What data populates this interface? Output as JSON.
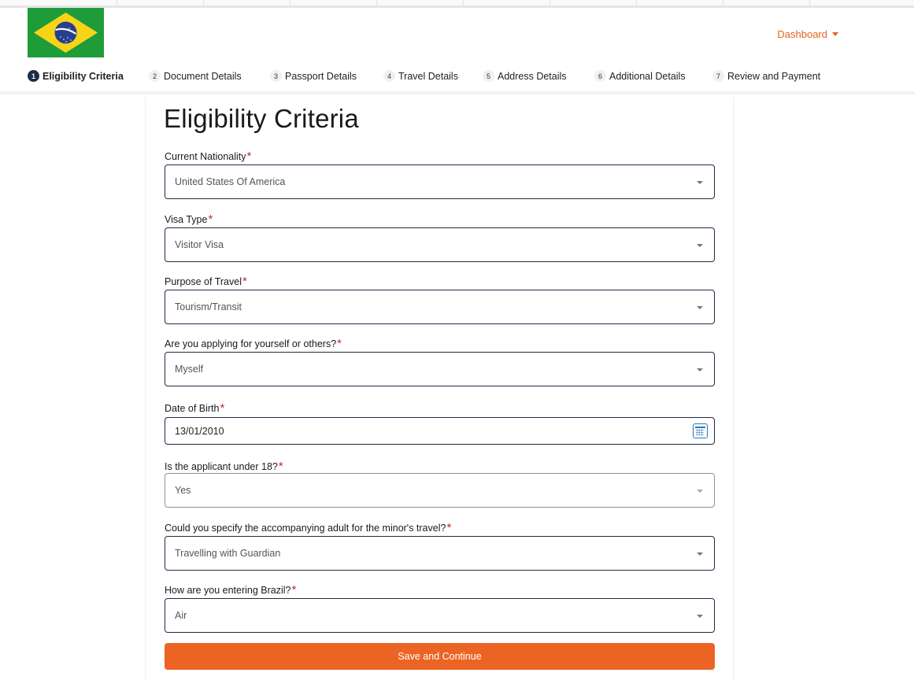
{
  "header": {
    "dashboard_label": "Dashboard"
  },
  "steps": [
    {
      "num": "1",
      "label": "Eligibility Criteria"
    },
    {
      "num": "2",
      "label": "Document Details"
    },
    {
      "num": "3",
      "label": "Passport Details"
    },
    {
      "num": "4",
      "label": "Travel Details"
    },
    {
      "num": "5",
      "label": "Address Details"
    },
    {
      "num": "6",
      "label": "Additional Details"
    },
    {
      "num": "7",
      "label": "Review and Payment"
    }
  ],
  "form": {
    "title": "Eligibility Criteria",
    "required_mark": "*",
    "fields": [
      {
        "label": "Current Nationality",
        "value": "United States Of America"
      },
      {
        "label": "Visa Type",
        "value": "Visitor Visa"
      },
      {
        "label": "Purpose of Travel",
        "value": "Tourism/Transit"
      },
      {
        "label": "Are you applying for yourself or others?",
        "value": "Myself"
      },
      {
        "label": "Date of Birth",
        "value": "13/01/2010"
      },
      {
        "label": "Is the applicant under 18?",
        "value": "Yes"
      },
      {
        "label": "Could you specify the accompanying adult for the minor's travel?",
        "value": "Travelling with Guardian"
      },
      {
        "label": "How are you entering Brazil?",
        "value": "Air"
      }
    ],
    "submit_label": "Save and Continue"
  },
  "colors": {
    "accent": "#eb6424",
    "active_step": "#1d2b4a",
    "required": "#c62828"
  },
  "icons": {
    "flag": "brazil-flag",
    "calendar": "calendar-icon",
    "dropdown": "chevron-down-icon"
  }
}
